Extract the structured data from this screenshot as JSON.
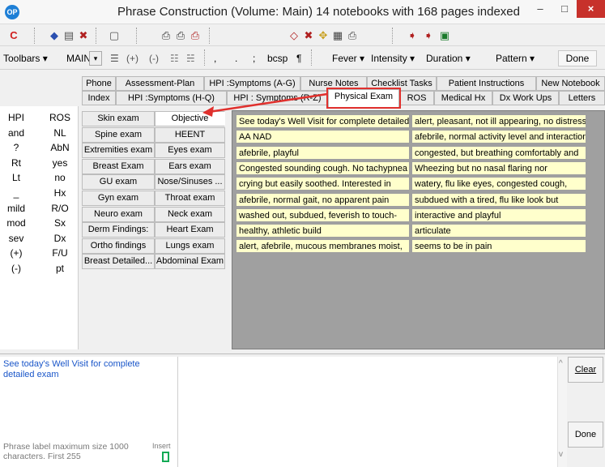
{
  "window": {
    "logo": "OP",
    "title": "Phrase Construction (Volume: Main)  14 notebooks with 168 pages indexed",
    "minimize": "–",
    "maximize": "□",
    "close": "×"
  },
  "iconbar": {
    "icons": [
      "refresh-icon",
      "tag-icon",
      "book-icon",
      "cancel-book-icon",
      "page-icon",
      "print-icon",
      "print-alt-icon",
      "print-cancel-icon",
      "eraser-icon",
      "eraser-cancel-icon",
      "move-icon",
      "properties-icon",
      "printer-icon",
      "export-icon",
      "import-icon",
      "notebook-icon"
    ]
  },
  "textbar": {
    "toolbars_label": "Toolbars ▾",
    "main_select": "MAIN",
    "list_icon": "☰",
    "plus": "(+)",
    "minus": "(-)",
    "bullets_icon": "☷",
    "numbers_icon": "☵",
    "comma": ",",
    "period": ".",
    "semicolon": ";",
    "bcsp": "bcsp",
    "pilcrow": "¶",
    "fever": "Fever ▾",
    "intensity": "Intensity ▾",
    "duration": "Duration ▾",
    "pattern": "Pattern ▾",
    "done": "Done"
  },
  "tabs_top": [
    "Phone",
    "Assessment-Plan",
    "HPI :Symptoms (A-G)",
    "Nurse Notes",
    "Checklist Tasks",
    "Patient Instructions",
    "New Notebook"
  ],
  "tabs_bottom": [
    "Index",
    "HPI :Symptoms (H-Q)",
    "HPI : Symptoms (R-Z)",
    "Physical Exam",
    "ROS",
    "Medical Hx",
    "Dx Work Ups",
    "Letters"
  ],
  "left_col_a": [
    "HPI",
    "and",
    "?",
    "Rt",
    "Lt",
    "_",
    "mild",
    "mod",
    "sev",
    "(+)",
    "(-)"
  ],
  "left_col_b": [
    "ROS",
    "NL",
    "AbN",
    "yes",
    "no",
    "Hx",
    "R/O",
    "Sx",
    "Dx",
    "F/U",
    "pt"
  ],
  "exam_left": [
    "Skin exam",
    "Spine exam",
    "Extremities exam",
    "Breast Exam",
    "GU exam",
    "Gyn exam",
    "Neuro exam",
    "Derm Findings:",
    "Ortho findings",
    "Breast Detailed..."
  ],
  "exam_right": [
    "Objective",
    "HEENT",
    "Eyes exam",
    "Ears exam",
    "Nose/Sinuses ...",
    "Throat exam",
    "Neck exam",
    "Heart Exam",
    "Lungs exam",
    "Abdominal Exam"
  ],
  "phrases_left": [
    "See today's Well Visit for complete detailed exam",
    "AA NAD",
    "afebrile, playful",
    "Congested sounding cough.  No tachypnea",
    "crying but easily soothed. Interested in",
    "afebrile, normal gait, no apparent pain",
    "washed out, subdued, feverish to touch-",
    "healthy, athletic build",
    "alert, afebrile, mucous membranes moist,"
  ],
  "phrases_right": [
    "alert, pleasant, not ill appearing, no distress",
    "afebrile, normal activity level and interaction",
    "congested, but breathing comfortably and",
    "Wheezing but no nasal flaring nor",
    "watery, flu like eyes,  congested cough,",
    "subdued with a tired, flu like look but",
    "interactive and playful",
    "articulate",
    "seems to be in pain"
  ],
  "bottom": {
    "preview": "See today's Well Visit for complete detailed exam",
    "max_size": "Phrase label maximum size 1000 characters. First 255",
    "insert": "Insert",
    "clear": "Clear",
    "done": "Done",
    "scroll_up": "^",
    "scroll_down": "v"
  },
  "colors": {
    "phrase_bg": "#ffffcc",
    "highlight": "#e0302d",
    "preview_text": "#1a56c9",
    "close_btn": "#c7312b"
  }
}
